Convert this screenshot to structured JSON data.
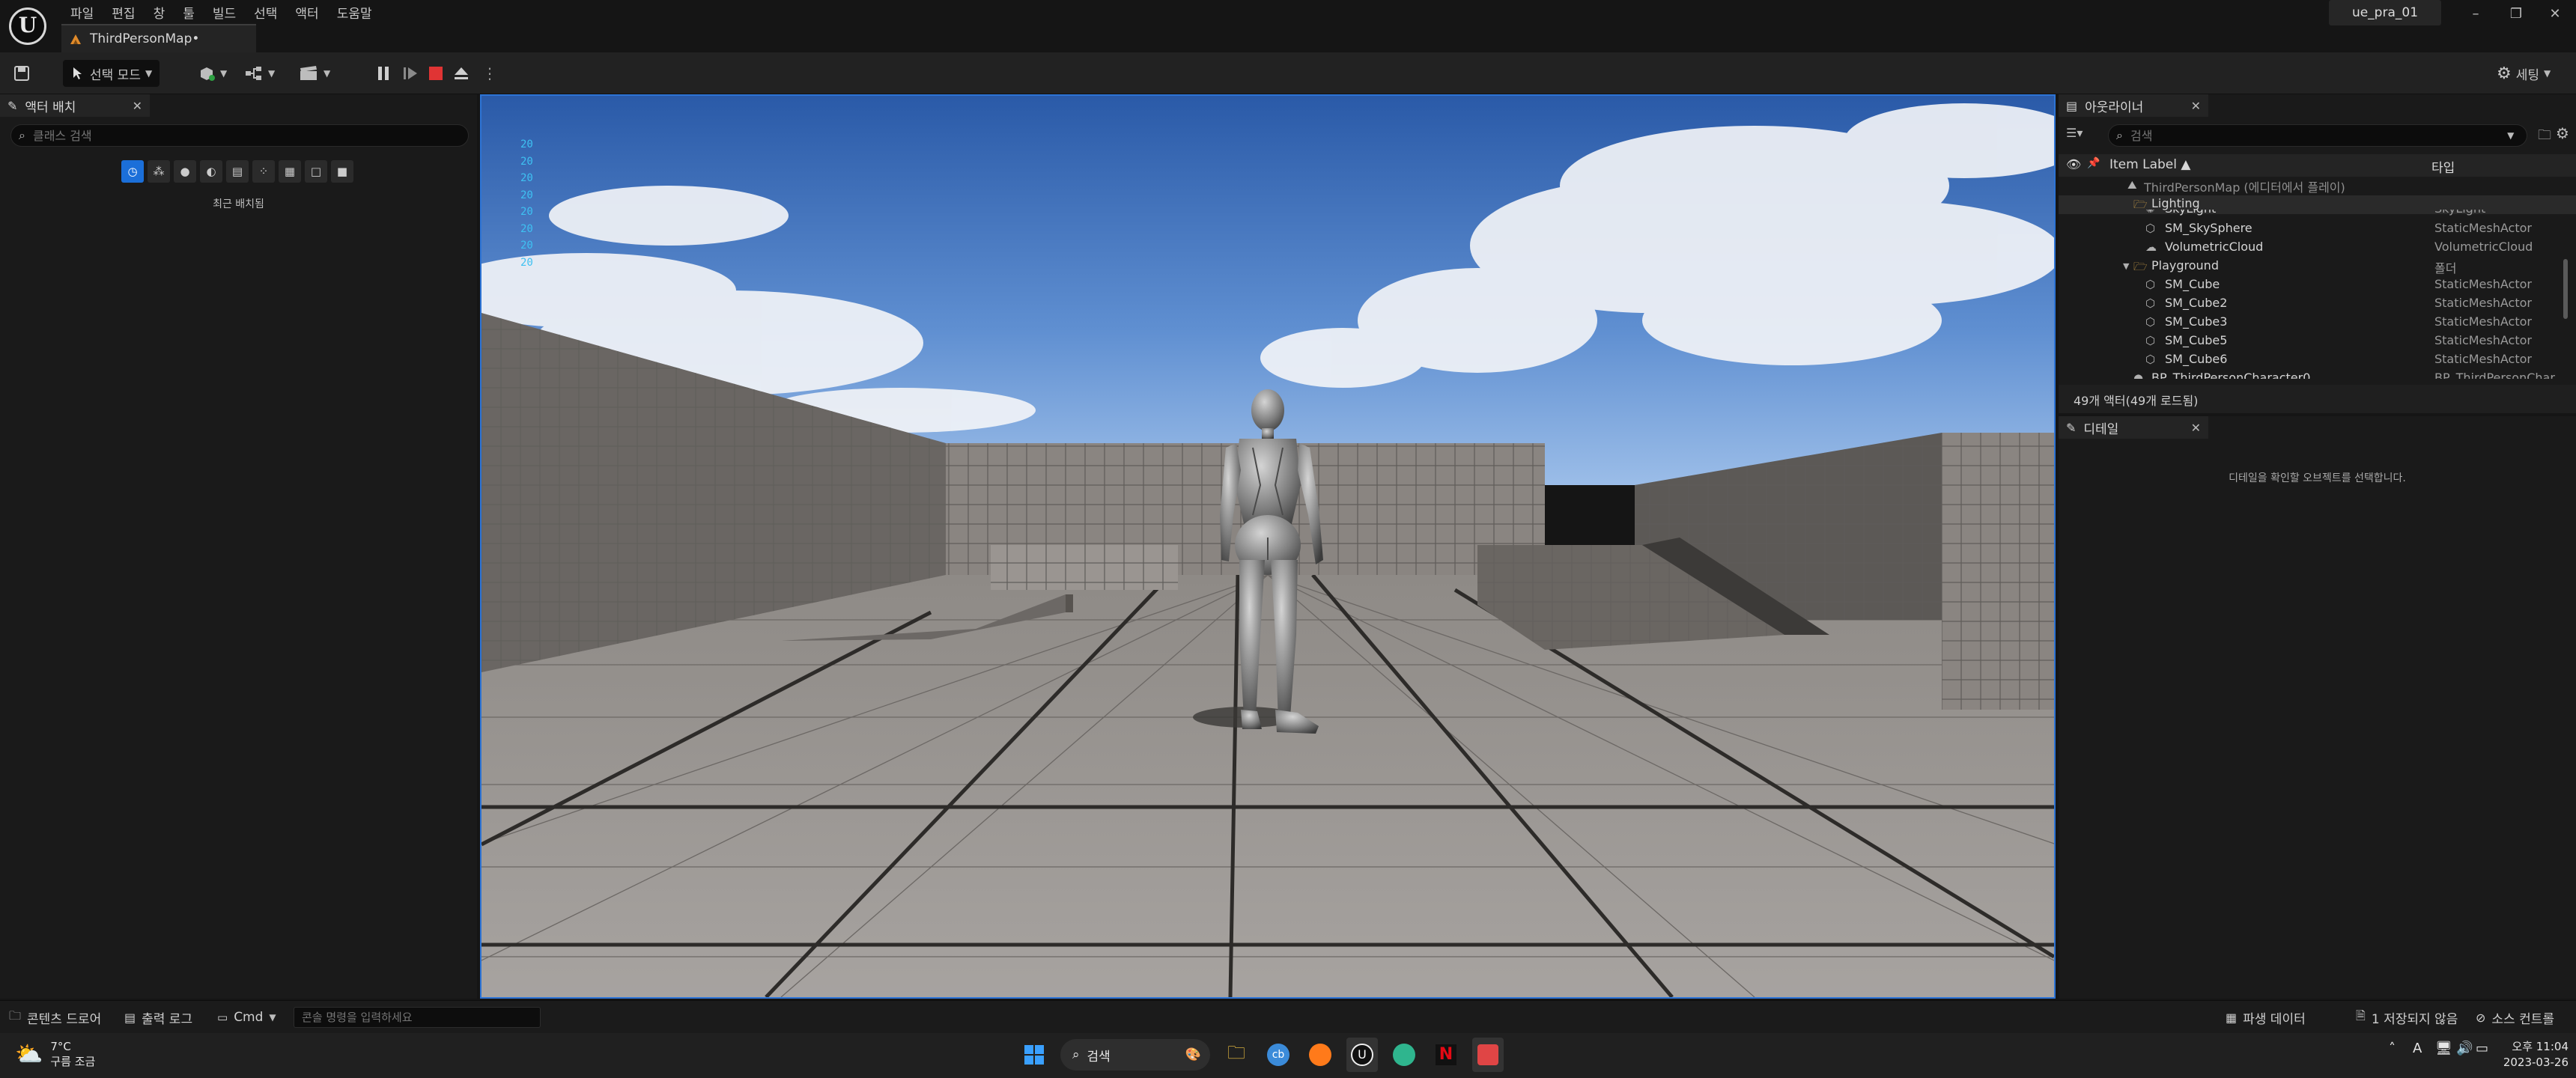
{
  "window": {
    "menus": [
      "파일",
      "편집",
      "창",
      "툴",
      "빌드",
      "선택",
      "액터",
      "도움말"
    ],
    "doc_tab": "ThirdPersonMap•",
    "project": "ue_pra_01"
  },
  "toolbar": {
    "mode": "선택 모드",
    "settings": "세팅"
  },
  "place_actors": {
    "tab": "액터 배치",
    "search_placeholder": "클래스 검색",
    "recent": "최근 배치됨"
  },
  "viewport": {
    "stats": [
      "20",
      "20",
      "20",
      "20",
      "20",
      "20",
      "20",
      "20"
    ]
  },
  "outliner": {
    "tab": "아웃라이너",
    "search_placeholder": "검색",
    "col_label": "Item Label",
    "col_type": "타입",
    "rows": [
      {
        "label": "ThirdPersonMap (에디터에서 플레이)",
        "type": ""
      },
      {
        "label": "Lighting",
        "type": ""
      },
      {
        "label": "SkyLight",
        "type": "SkyLight"
      },
      {
        "label": "SM_SkySphere",
        "type": "StaticMeshActor"
      },
      {
        "label": "VolumetricCloud",
        "type": "VolumetricCloud"
      },
      {
        "label": "Playground",
        "type": "폴더"
      },
      {
        "label": "SM_Cube",
        "type": "StaticMeshActor"
      },
      {
        "label": "SM_Cube2",
        "type": "StaticMeshActor"
      },
      {
        "label": "SM_Cube3",
        "type": "StaticMeshActor"
      },
      {
        "label": "SM_Cube5",
        "type": "StaticMeshActor"
      },
      {
        "label": "SM_Cube6",
        "type": "StaticMeshActor"
      },
      {
        "label": "BP_ThirdPersonCharacter0",
        "type": "BP_ThirdPersonChar"
      }
    ],
    "count": "49개 액터(49개 로드됨)"
  },
  "details": {
    "tab": "디테일",
    "message": "디테일을 확인할 오브젝트를 선택합니다."
  },
  "statusbar": {
    "content_drawer": "콘텐츠 드로어",
    "output_log": "출력 로그",
    "cmd": "Cmd",
    "console_placeholder": "콘솔 명령을 입력하세요",
    "derived_data": "파생 데이터",
    "unsaved": "1 저장되지 않음",
    "source_control": "소스 컨트롤"
  },
  "taskbar": {
    "temp": "7°C",
    "weather": "구름 조금",
    "search": "검색",
    "time": "오후 11:04",
    "date": "2023-03-26",
    "ime": "A"
  }
}
